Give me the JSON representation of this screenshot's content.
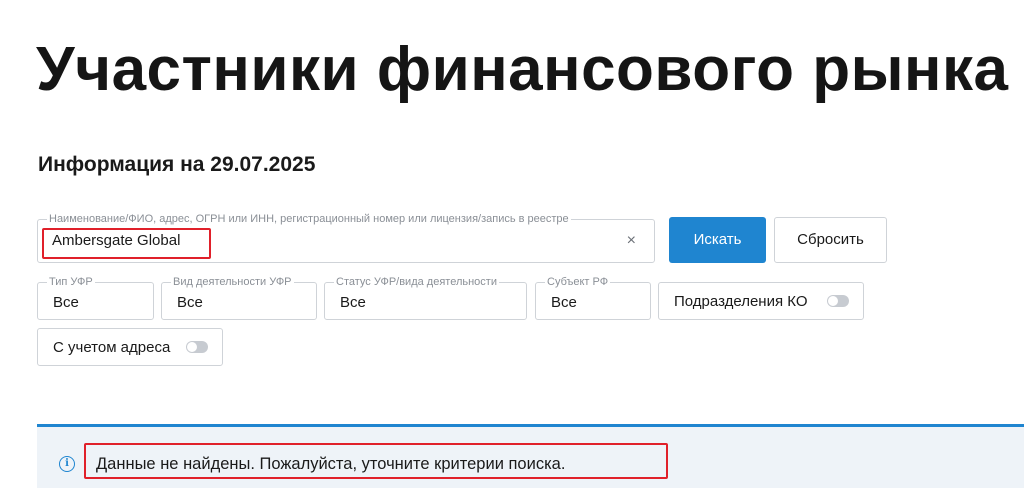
{
  "page": {
    "title": "Участники финансового рынка",
    "info_date": "Информация на 29.07.2025"
  },
  "search": {
    "label": "Наименование/ФИО, адрес, ОГРН или ИНН, регистрационный номер или лицензия/запись в реестре",
    "value": "Ambersgate Global",
    "clear_icon": "×"
  },
  "buttons": {
    "search_label": "Искать",
    "reset_label": "Сбросить"
  },
  "filters": [
    {
      "label": "Тип УФР",
      "value": "Все"
    },
    {
      "label": "Вид деятельности УФР",
      "value": "Все"
    },
    {
      "label": "Статус УФР/вида деятельности",
      "value": "Все"
    },
    {
      "label": "Субъект РФ",
      "value": "Все"
    }
  ],
  "toggles": {
    "ko_subdivisions": {
      "label": "Подразделения КО",
      "on": false
    },
    "with_address": {
      "label": "С учетом адреса",
      "on": false
    }
  },
  "notice": {
    "icon": "info-icon",
    "text": "Данные не найдены. Пожалуйста, уточните критерии поиска."
  },
  "colors": {
    "accent": "#1f85d0",
    "highlight": "#e0202a",
    "notice_bg": "#eef3f8"
  }
}
